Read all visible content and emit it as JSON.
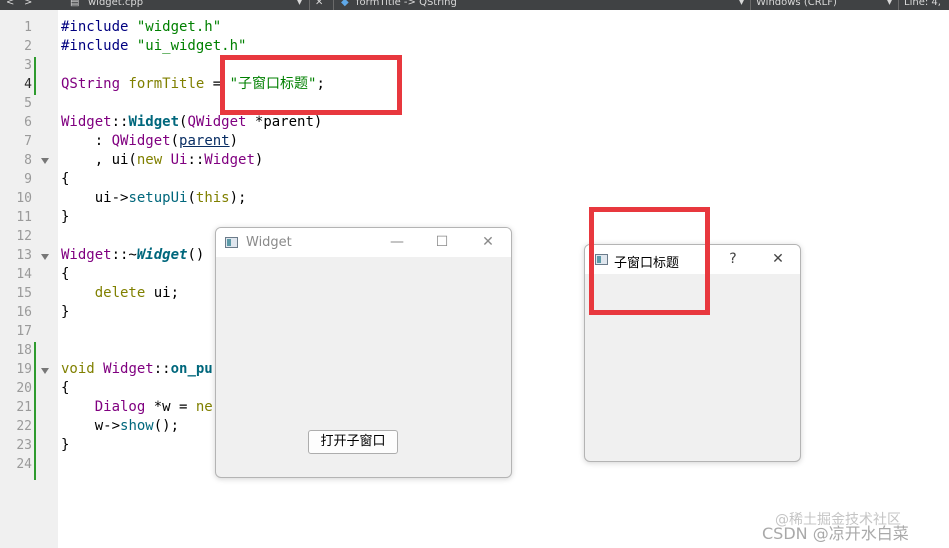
{
  "toolbar": {
    "file_name": "widget.cpp",
    "symbol": "formTitle -> QString",
    "line_ending": "Windows (CRLF)",
    "position": "Line: 4,"
  },
  "editor": {
    "current_line": 4,
    "line_numbers": [
      "1",
      "2",
      "3",
      "4",
      "5",
      "6",
      "7",
      "8",
      "9",
      "10",
      "11",
      "12",
      "13",
      "14",
      "15",
      "16",
      "17",
      "18",
      "19",
      "20",
      "21",
      "22",
      "23",
      "24"
    ],
    "lines": [
      {
        "n": 1,
        "tokens": [
          {
            "t": "#include ",
            "c": "pp"
          },
          {
            "t": "\"widget.h\"",
            "c": "str"
          }
        ]
      },
      {
        "n": 2,
        "tokens": [
          {
            "t": "#include ",
            "c": "pp"
          },
          {
            "t": "\"ui_widget.h\"",
            "c": "str"
          }
        ]
      },
      {
        "n": 3,
        "tokens": []
      },
      {
        "n": 4,
        "tokens": [
          {
            "t": "QString ",
            "c": "ty"
          },
          {
            "t": "formTitle",
            "c": "kw"
          },
          {
            "t": " = ",
            "c": ""
          },
          {
            "t": "\"子窗口标题\"",
            "c": "str"
          },
          {
            "t": ";",
            "c": ""
          }
        ]
      },
      {
        "n": 5,
        "tokens": []
      },
      {
        "n": 6,
        "tokens": [
          {
            "t": "Widget",
            "c": "ty"
          },
          {
            "t": "::",
            "c": ""
          },
          {
            "t": "Widget",
            "c": "fnb"
          },
          {
            "t": "(",
            "c": ""
          },
          {
            "t": "QWidget",
            "c": "ty"
          },
          {
            "t": " *parent)",
            "c": ""
          }
        ]
      },
      {
        "n": 7,
        "tokens": [
          {
            "t": "    : ",
            "c": ""
          },
          {
            "t": "QWidget",
            "c": "ty"
          },
          {
            "t": "(",
            "c": ""
          },
          {
            "t": "parent",
            "c": "par"
          },
          {
            "t": ")",
            "c": ""
          }
        ]
      },
      {
        "n": 8,
        "tokens": [
          {
            "t": "    , ui(",
            "c": ""
          },
          {
            "t": "new ",
            "c": "kw"
          },
          {
            "t": "Ui",
            "c": "ty"
          },
          {
            "t": "::",
            "c": ""
          },
          {
            "t": "Widget",
            "c": "ty"
          },
          {
            "t": ")",
            "c": ""
          }
        ]
      },
      {
        "n": 9,
        "tokens": [
          {
            "t": "{",
            "c": ""
          }
        ]
      },
      {
        "n": 10,
        "tokens": [
          {
            "t": "    ui->",
            "c": ""
          },
          {
            "t": "setupUi",
            "c": "fn"
          },
          {
            "t": "(",
            "c": ""
          },
          {
            "t": "this",
            "c": "kw"
          },
          {
            "t": ");",
            "c": ""
          }
        ]
      },
      {
        "n": 11,
        "tokens": [
          {
            "t": "}",
            "c": ""
          }
        ]
      },
      {
        "n": 12,
        "tokens": []
      },
      {
        "n": 13,
        "tokens": [
          {
            "t": "Widget",
            "c": "ty"
          },
          {
            "t": "::~",
            "c": ""
          },
          {
            "t": "Widget",
            "c": "fni"
          },
          {
            "t": "()",
            "c": ""
          }
        ]
      },
      {
        "n": 14,
        "tokens": [
          {
            "t": "{",
            "c": ""
          }
        ]
      },
      {
        "n": 15,
        "tokens": [
          {
            "t": "    ",
            "c": ""
          },
          {
            "t": "delete",
            "c": "kw"
          },
          {
            "t": " ui;",
            "c": ""
          }
        ]
      },
      {
        "n": 16,
        "tokens": [
          {
            "t": "}",
            "c": ""
          }
        ]
      },
      {
        "n": 17,
        "tokens": []
      },
      {
        "n": 18,
        "tokens": []
      },
      {
        "n": 19,
        "tokens": [
          {
            "t": "void ",
            "c": "kw"
          },
          {
            "t": "Widget",
            "c": "ty"
          },
          {
            "t": "::",
            "c": ""
          },
          {
            "t": "on_pu",
            "c": "fnb"
          }
        ]
      },
      {
        "n": 20,
        "tokens": [
          {
            "t": "{",
            "c": ""
          }
        ]
      },
      {
        "n": 21,
        "tokens": [
          {
            "t": "    ",
            "c": ""
          },
          {
            "t": "Dialog",
            "c": "ty"
          },
          {
            "t": " *w = ",
            "c": ""
          },
          {
            "t": "ne",
            "c": "kw"
          }
        ]
      },
      {
        "n": 22,
        "tokens": [
          {
            "t": "    w->",
            "c": ""
          },
          {
            "t": "show",
            "c": "fn"
          },
          {
            "t": "();",
            "c": ""
          }
        ]
      },
      {
        "n": 23,
        "tokens": [
          {
            "t": "}",
            "c": ""
          }
        ]
      },
      {
        "n": 24,
        "tokens": []
      }
    ]
  },
  "main_window": {
    "title": "Widget",
    "minimize": "—",
    "maximize": "☐",
    "close": "✕",
    "open_button": "打开子窗口"
  },
  "child_dialog": {
    "title": "子窗口标题",
    "help": "?",
    "close": "✕"
  },
  "watermark": "CSDN @凉开水白菜",
  "watermark2": "@稀土掘金技术社区",
  "colors": {
    "highlight": "#e8383e",
    "string": "#008000",
    "type": "#800080",
    "keyword": "#808000"
  }
}
